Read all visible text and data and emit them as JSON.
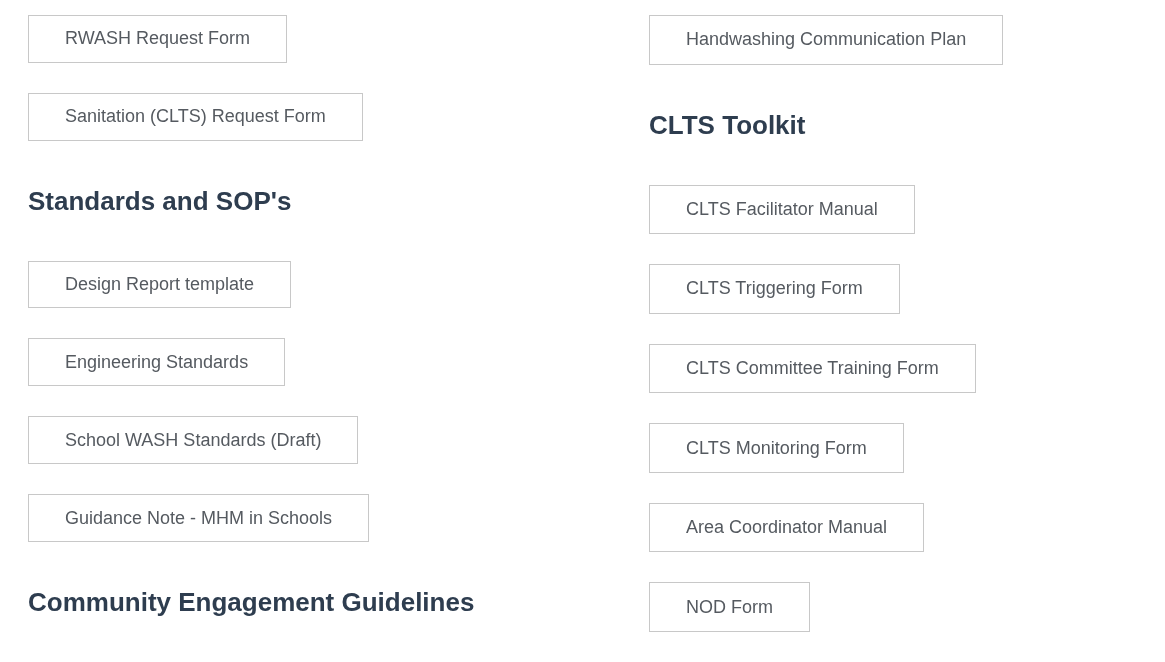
{
  "columns": [
    {
      "items": [
        {
          "kind": "button",
          "label": "RWASH Request Form"
        },
        {
          "kind": "button",
          "label": "Sanitation (CLTS) Request Form"
        },
        {
          "kind": "heading",
          "label": "Standards and SOP's"
        },
        {
          "kind": "button",
          "label": "Design Report template"
        },
        {
          "kind": "button",
          "label": "Engineering Standards"
        },
        {
          "kind": "button",
          "label": "School WASH Standards (Draft)"
        },
        {
          "kind": "button",
          "label": "Guidance Note - MHM in Schools"
        },
        {
          "kind": "heading",
          "label": "Community Engagement Guidelines"
        }
      ]
    },
    {
      "items": [
        {
          "kind": "button",
          "label": "Handwashing Communication Plan"
        },
        {
          "kind": "heading",
          "label": "CLTS Toolkit"
        },
        {
          "kind": "button",
          "label": "CLTS Facilitator Manual"
        },
        {
          "kind": "button",
          "label": "CLTS Triggering Form"
        },
        {
          "kind": "button",
          "label": "CLTS Committee Training Form"
        },
        {
          "kind": "button",
          "label": "CLTS Monitoring Form"
        },
        {
          "kind": "button",
          "label": "Area Coordinator Manual"
        },
        {
          "kind": "button",
          "label": "NOD Form"
        }
      ]
    }
  ]
}
